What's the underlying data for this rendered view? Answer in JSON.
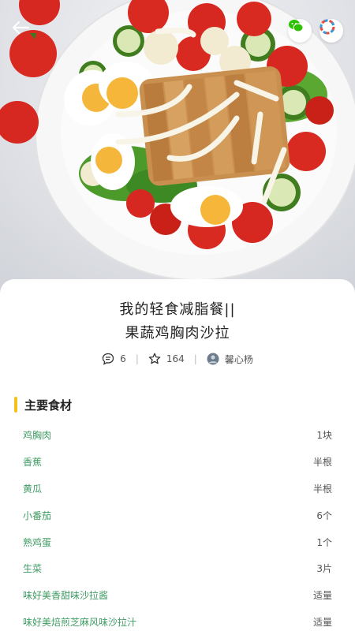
{
  "recipe": {
    "title_line1": "我的轻食减脂餐||",
    "title_line2": "果蔬鸡胸肉沙拉",
    "comments_count": "6",
    "favorites_count": "164",
    "author_name": "馨心杨"
  },
  "icons": {
    "back": "back-arrow-icon",
    "share_wechat": "wechat-icon",
    "share_moments": "moments-icon",
    "comment": "comment-icon",
    "favorite": "star-icon"
  },
  "ingredients_section": {
    "title": "主要食材",
    "accent_color": "#f2c21b",
    "items": [
      {
        "name": "鸡胸肉",
        "qty": "1块"
      },
      {
        "name": "香蕉",
        "qty": "半根"
      },
      {
        "name": "黄瓜",
        "qty": "半根"
      },
      {
        "name": "小番茄",
        "qty": "6个"
      },
      {
        "name": "熟鸡蛋",
        "qty": "1个"
      },
      {
        "name": "生菜",
        "qty": "3片"
      },
      {
        "name": "味好美香甜味沙拉酱",
        "qty": "适量"
      },
      {
        "name": "味好美焙煎芝麻风味沙拉汁",
        "qty": "适量"
      }
    ]
  },
  "colors": {
    "ingredient_name": "#3f9b63",
    "wechat_green": "#2dc100"
  }
}
